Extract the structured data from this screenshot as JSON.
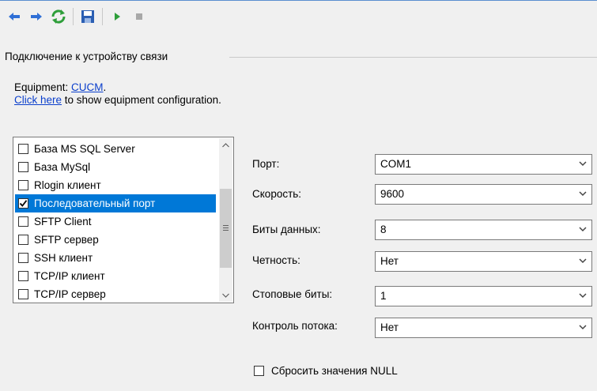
{
  "toolbar": {
    "buttons": [
      {
        "icon": "arrow-left-icon"
      },
      {
        "icon": "arrow-right-icon"
      },
      {
        "icon": "refresh-icon"
      },
      {
        "icon": "save-icon"
      },
      {
        "icon": "play-icon"
      },
      {
        "icon": "stop-icon"
      }
    ]
  },
  "group": {
    "title": "Подключение к устройству связи"
  },
  "equipment": {
    "prefix": "Equipment: ",
    "link": "CUCM",
    "suffix": ".",
    "config_link": "Click here",
    "config_text": " to show equipment configuration."
  },
  "connection_types": {
    "items": [
      {
        "label": "База MS SQL Server",
        "checked": false,
        "selected": false
      },
      {
        "label": "База MySql",
        "checked": false,
        "selected": false
      },
      {
        "label": "Rlogin клиент",
        "checked": false,
        "selected": false
      },
      {
        "label": "Последовательный порт",
        "checked": true,
        "selected": true
      },
      {
        "label": "SFTP Client",
        "checked": false,
        "selected": false
      },
      {
        "label": "SFTP сервер",
        "checked": false,
        "selected": false
      },
      {
        "label": "SSH клиент",
        "checked": false,
        "selected": false
      },
      {
        "label": "TCP/IP клиент",
        "checked": false,
        "selected": false
      },
      {
        "label": "TCP/IP сервер",
        "checked": false,
        "selected": false
      }
    ]
  },
  "settings": {
    "port": {
      "label": "Порт:",
      "value": "COM1"
    },
    "speed": {
      "label": "Скорость:",
      "value": "9600"
    },
    "data_bits": {
      "label": "Биты данных:",
      "value": "8"
    },
    "parity": {
      "label": "Четность:",
      "value": "Нет"
    },
    "stop_bits": {
      "label": "Стоповые биты:",
      "value": "1"
    },
    "flow_control": {
      "label": "Контроль потока:",
      "value": "Нет"
    }
  },
  "reset_null": {
    "label": "Сбросить значения NULL",
    "checked": false
  },
  "colors": {
    "selection": "#0078d7",
    "link": "#0b3fcc",
    "background": "#f0f0f0"
  }
}
